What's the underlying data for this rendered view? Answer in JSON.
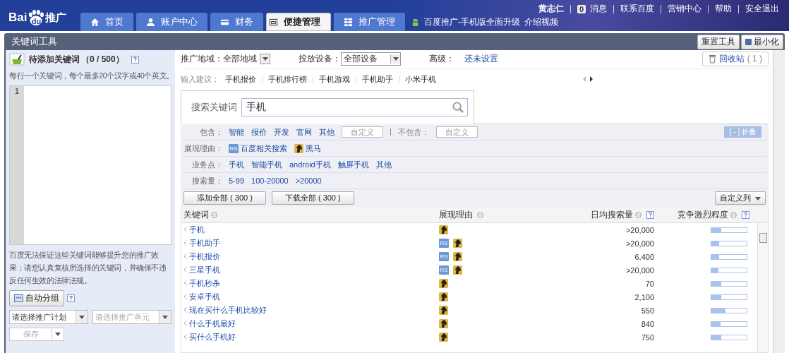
{
  "header": {
    "logo": {
      "bai": "Bai",
      "du": "du",
      "suffix": "推广"
    },
    "tabs": [
      {
        "label": "首页",
        "selected": false
      },
      {
        "label": "账户中心",
        "selected": false
      },
      {
        "label": "财务",
        "selected": false
      },
      {
        "label": "便捷管理",
        "selected": true
      },
      {
        "label": "推广管理",
        "selected": false
      }
    ],
    "promo": {
      "text": "百度推广-手机版全面升级",
      "link": "介绍视频"
    },
    "user": "黄志仁",
    "message_count": "0",
    "messages": "消息",
    "links": [
      "联系百度",
      "营销中心",
      "帮助",
      "安全退出"
    ]
  },
  "tool": {
    "title": "关键词工具",
    "reset": "重置工具",
    "minimize": "最小化"
  },
  "left": {
    "title": "待添加关键词",
    "count": "（0 / 500）",
    "hint": "每行一个关键词，每个最多20个汉字或40个英文。",
    "line_number": "1",
    "notice": "百度无法保证这些关键词能够提升您的推广效果；请您认真复核所选择的关键词，并确保不违反任何生效的法律法规。",
    "auto_group": "自动分组",
    "plan_select": "请选择推广计划",
    "unit_select": {
      "placeholder": "请选择推广单元",
      "disabled": true
    },
    "save": {
      "label": "保存",
      "disabled": true
    }
  },
  "filters": {
    "region_label": "推广地域：",
    "region": "全部地域",
    "device_label": "投放设备：",
    "device": "全部设备",
    "advanced_label": "高级：",
    "advanced": "还未设置",
    "recycle": "回收站",
    "recycle_count": "( 1 )"
  },
  "suggestions": {
    "label": "输入建议：",
    "items": [
      "手机报价",
      "手机排行榜",
      "手机游戏",
      "手机助手",
      "小米手机"
    ]
  },
  "search": {
    "tab": "搜索关键词",
    "value": "手机"
  },
  "refine": {
    "collapse": "[ - ] 折叠",
    "include_label": "包含：",
    "include": [
      "智能",
      "报价",
      "开发",
      "官网",
      "其他"
    ],
    "include_custom": "自定义",
    "exclude_label": "不包含：",
    "exclude_custom": "自定义",
    "reason_label": "展现理由：",
    "reasons": [
      {
        "kind": "rs",
        "badge": "RS",
        "label": "百度相关搜索"
      },
      {
        "kind": "dark_horse",
        "label": "黑马"
      }
    ],
    "business_label": "业务点：",
    "business": [
      "手机",
      "智能手机",
      "android手机",
      "触屏手机",
      "其他"
    ],
    "volume_label": "搜索量：",
    "volume": [
      "5-99",
      "100-20000",
      ">20000"
    ]
  },
  "actions": {
    "add_all": "添加全部 ( 300 )",
    "download_all": "下载全部 ( 300 )",
    "columns": "自定义列"
  },
  "table": {
    "columns": [
      "关键词",
      "展现理由",
      "日均搜索量",
      "竞争激烈程度"
    ],
    "rows": [
      {
        "keyword": "手机",
        "reasons": [
          {
            "kind": "dark_horse"
          }
        ],
        "volume": ">20,000",
        "level": 0.28
      },
      {
        "keyword": "手机助手",
        "reasons": [
          {
            "kind": "rs",
            "badge": "RS"
          },
          {
            "kind": "dark_horse"
          }
        ],
        "volume": ">20,000",
        "level": 0.22
      },
      {
        "keyword": "手机报价",
        "reasons": [
          {
            "kind": "rs",
            "badge": "RS"
          },
          {
            "kind": "dark_horse"
          }
        ],
        "volume": "6,400",
        "level": 0.22
      },
      {
        "keyword": "三星手机",
        "reasons": [
          {
            "kind": "rs",
            "badge": "RS"
          },
          {
            "kind": "dark_horse"
          }
        ],
        "volume": ">20,000",
        "level": 0.2
      },
      {
        "keyword": "手机秒杀",
        "reasons": [
          {
            "kind": "dark_horse"
          }
        ],
        "volume": "70",
        "level": 0.27
      },
      {
        "keyword": "安卓手机",
        "reasons": [
          {
            "kind": "dark_horse"
          }
        ],
        "volume": "2,100",
        "level": 0.28
      },
      {
        "keyword": "现在买什么手机比较好",
        "reasons": [
          {
            "kind": "dark_horse"
          }
        ],
        "volume": "550",
        "level": 0.4
      },
      {
        "keyword": "什么手机最好",
        "reasons": [
          {
            "kind": "dark_horse"
          }
        ],
        "volume": "840",
        "level": 0.25
      },
      {
        "keyword": "买什么手机好",
        "reasons": [
          {
            "kind": "dark_horse"
          }
        ],
        "volume": "750",
        "level": 0.28
      }
    ]
  }
}
